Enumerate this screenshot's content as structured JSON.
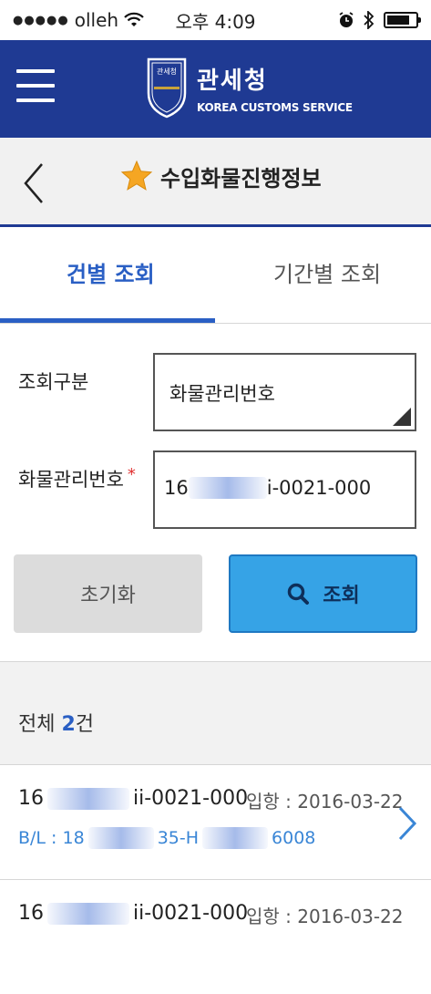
{
  "status": {
    "carrier": "olleh",
    "time": "오후 4:09"
  },
  "header": {
    "title": "관세청",
    "subtitle": "KOREA CUSTOMS SERVICE",
    "emblem_text_top": "관세청",
    "emblem_text_mid": "KOREA CUSTOMS SERVICE",
    "emblem_text_year": "1970",
    "brand_color": "#1f3a93"
  },
  "titlebar": {
    "title": "수입화물진행정보",
    "star_color": "#f5a623"
  },
  "tabs": {
    "active": "건별 조회",
    "inactive": "기간별 조회",
    "active_color": "#2a5fc4"
  },
  "form": {
    "category_label": "조회구분",
    "category_value": "화물관리번호",
    "number_label": "화물관리번호",
    "required_mark": "*",
    "number_prefix": "16",
    "number_suffix": "i-0021-000",
    "reset_label": "초기화",
    "search_label": "조회",
    "search_color": "#36a3e6"
  },
  "results": {
    "total_prefix": "전체",
    "total_count": "2",
    "total_suffix": "건",
    "items": [
      {
        "number_prefix": "16",
        "number_suffix": "ii-0021-000",
        "arrival": "입항 : 2016-03-22",
        "bl_prefix": "B/L : 18",
        "bl_mid": "35-H",
        "bl_suffix": "6008"
      },
      {
        "number_prefix": "16",
        "number_suffix": "ii-0021-000",
        "arrival": "입항 : 2016-03-22"
      }
    ]
  }
}
